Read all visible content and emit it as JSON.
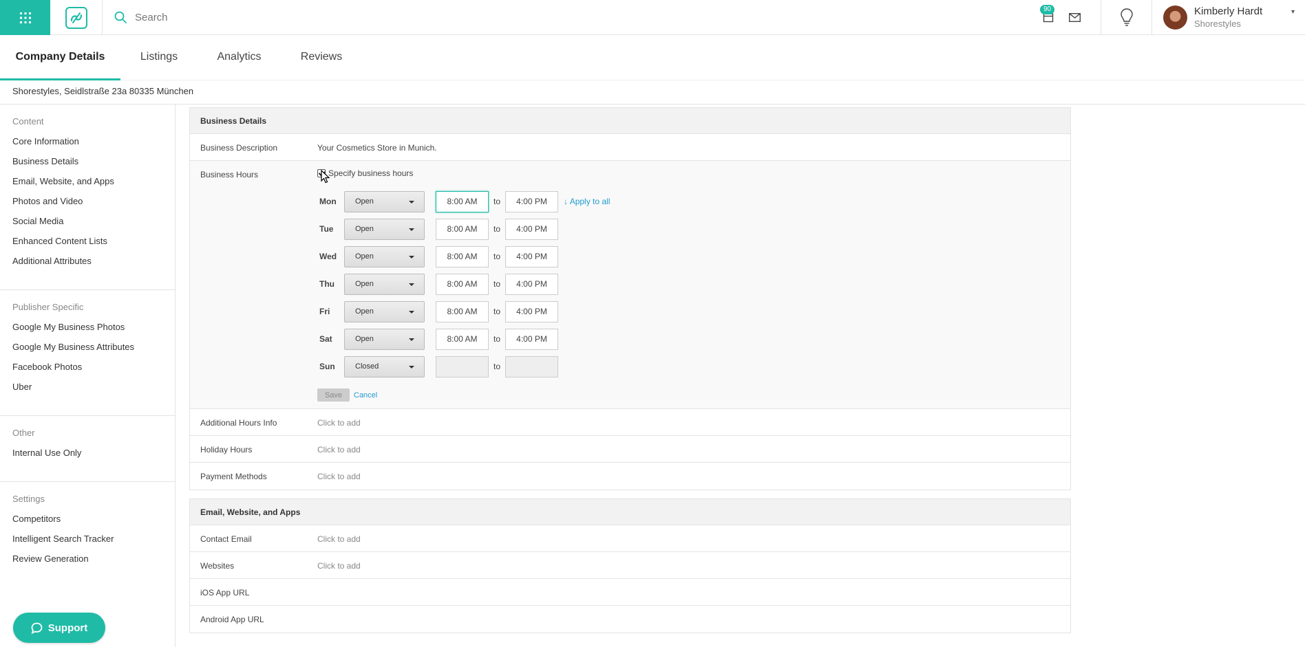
{
  "topbar": {
    "search_placeholder": "Search",
    "notification_count": "90",
    "user_name": "Kimberly Hardt",
    "user_company": "Shorestyles",
    "accent": "#1fbba6"
  },
  "tabs": [
    {
      "label": "Company Details"
    },
    {
      "label": "Listings"
    },
    {
      "label": "Analytics"
    },
    {
      "label": "Reviews"
    }
  ],
  "address": "Shorestyles, Seidlstraße 23a 80335 München",
  "sidebar": {
    "groups": [
      {
        "heading": "Content",
        "items": [
          "Core Information",
          "Business Details",
          "Email, Website, and Apps",
          "Photos and Video",
          "Social Media",
          "Enhanced Content Lists",
          "Additional Attributes"
        ]
      },
      {
        "heading": "Publisher Specific",
        "items": [
          "Google My Business Photos",
          "Google My Business Attributes",
          "Facebook Photos",
          "Uber"
        ]
      },
      {
        "heading": "Other",
        "items": [
          "Internal Use Only"
        ]
      },
      {
        "heading": "Settings",
        "items": [
          "Competitors",
          "Intelligent Search Tracker",
          "Review Generation"
        ]
      }
    ],
    "support_label": "Support"
  },
  "business_details": {
    "heading": "Business Details",
    "description_label": "Business Description",
    "description_value": "Your Cosmetics Store in Munich.",
    "hours_label": "Business Hours",
    "specify_label": "Specify business hours",
    "to_label": "to",
    "apply_all_label": "↓ Apply to all",
    "days": [
      {
        "day": "Mon",
        "status": "Open",
        "open": "8:00 AM",
        "close": "4:00 PM"
      },
      {
        "day": "Tue",
        "status": "Open",
        "open": "8:00 AM",
        "close": "4:00 PM"
      },
      {
        "day": "Wed",
        "status": "Open",
        "open": "8:00 AM",
        "close": "4:00 PM"
      },
      {
        "day": "Thu",
        "status": "Open",
        "open": "8:00 AM",
        "close": "4:00 PM"
      },
      {
        "day": "Fri",
        "status": "Open",
        "open": "8:00 AM",
        "close": "4:00 PM"
      },
      {
        "day": "Sat",
        "status": "Open",
        "open": "8:00 AM",
        "close": "4:00 PM"
      },
      {
        "day": "Sun",
        "status": "Closed",
        "open": "",
        "close": ""
      }
    ],
    "save_label": "Save",
    "cancel_label": "Cancel",
    "additional_hours_label": "Additional Hours Info",
    "holiday_hours_label": "Holiday Hours",
    "payment_methods_label": "Payment Methods",
    "click_to_add": "Click to add"
  },
  "email_section": {
    "heading": "Email, Website, and Apps",
    "contact_email_label": "Contact Email",
    "websites_label": "Websites",
    "ios_label": "iOS App URL",
    "android_label": "Android App URL",
    "click_to_add": "Click to add"
  }
}
